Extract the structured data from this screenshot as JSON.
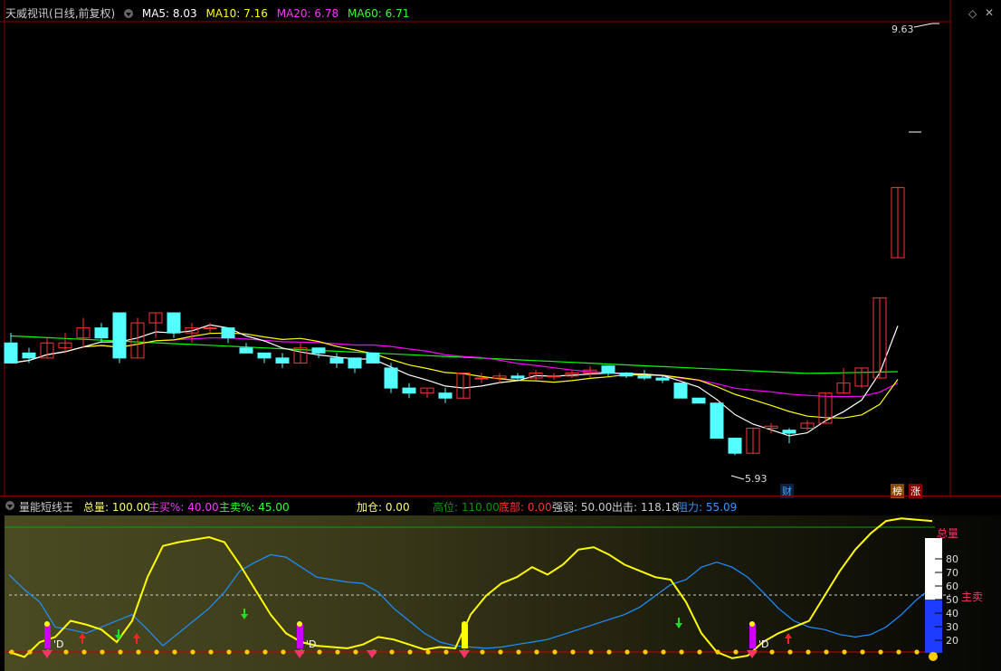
{
  "main": {
    "stock_name": "天威视讯",
    "period": "(日线,前复权)",
    "ma5_label": "MA5: 8.03",
    "ma10_label": "MA10: 7.16",
    "ma20_label": "MA20: 6.78",
    "ma60_label": "MA60: 6.71",
    "high_label": "9.63",
    "low_label": "5.93",
    "badge_cai": "财",
    "badge_bang": "榜",
    "badge_zhang": "涨",
    "colors": {
      "ma5": "#ffffff",
      "ma10": "#ffff00",
      "ma20": "#ff00ff",
      "ma60": "#00ff00",
      "up": "#ff3333",
      "down": "#54ffff"
    }
  },
  "sub": {
    "indicator_name": "量能短线王",
    "total": "总量: 100.00",
    "buy_pct": "主买%: 40.00",
    "sell_pct": "主卖%: 45.00",
    "add_pos": "加仓: 0.00",
    "high_pos": "高位: 110.00",
    "bottom": "底部: 0.00",
    "strength": "强弱: 50.00",
    "exit": "出击: 118.18",
    "resistance": "阻力: 55.09",
    "gauge_total_label": "总量",
    "gauge_sell_label": "主卖",
    "gauge_ticks": [
      "80",
      "70",
      "60",
      "50",
      "40",
      "30",
      "20"
    ],
    "d_label": "D"
  },
  "chart_data": {
    "type": "candlestick",
    "price_range": [
      5.6,
      10.2
    ],
    "candles_ohlc_approx": [
      [
        7.05,
        7.15,
        6.85,
        6.85
      ],
      [
        6.95,
        7.0,
        6.85,
        6.9
      ],
      [
        6.9,
        7.1,
        6.9,
        7.05
      ],
      [
        7.0,
        7.15,
        6.95,
        7.05
      ],
      [
        7.1,
        7.3,
        7.0,
        7.2
      ],
      [
        7.2,
        7.25,
        7.05,
        7.1
      ],
      [
        7.35,
        7.35,
        6.85,
        6.9
      ],
      [
        6.9,
        7.3,
        6.9,
        7.25
      ],
      [
        7.25,
        7.35,
        7.1,
        7.35
      ],
      [
        7.35,
        7.35,
        7.1,
        7.15
      ],
      [
        7.15,
        7.25,
        7.05,
        7.2
      ],
      [
        7.2,
        7.25,
        7.15,
        7.2
      ],
      [
        7.2,
        7.2,
        7.05,
        7.1
      ],
      [
        7.0,
        7.05,
        6.95,
        6.95
      ],
      [
        6.95,
        6.95,
        6.85,
        6.9
      ],
      [
        6.9,
        6.95,
        6.8,
        6.85
      ],
      [
        6.85,
        7.05,
        6.85,
        7.0
      ],
      [
        7.0,
        7.0,
        6.9,
        6.95
      ],
      [
        6.9,
        6.95,
        6.8,
        6.85
      ],
      [
        6.9,
        6.9,
        6.75,
        6.8
      ],
      [
        6.95,
        6.95,
        6.85,
        6.85
      ],
      [
        6.8,
        6.85,
        6.55,
        6.6
      ],
      [
        6.6,
        6.65,
        6.5,
        6.55
      ],
      [
        6.55,
        6.6,
        6.5,
        6.6
      ],
      [
        6.55,
        6.6,
        6.45,
        6.5
      ],
      [
        6.5,
        6.75,
        6.5,
        6.75
      ],
      [
        6.7,
        6.75,
        6.65,
        6.7
      ],
      [
        6.7,
        6.75,
        6.65,
        6.72
      ],
      [
        6.72,
        6.75,
        6.68,
        6.7
      ],
      [
        6.7,
        6.78,
        6.68,
        6.75
      ],
      [
        6.72,
        6.75,
        6.68,
        6.72
      ],
      [
        6.72,
        6.78,
        6.7,
        6.75
      ],
      [
        6.75,
        6.82,
        6.7,
        6.78
      ],
      [
        6.82,
        6.82,
        6.72,
        6.75
      ],
      [
        6.75,
        6.76,
        6.7,
        6.72
      ],
      [
        6.72,
        6.78,
        6.68,
        6.7
      ],
      [
        6.7,
        6.72,
        6.65,
        6.68
      ],
      [
        6.65,
        6.65,
        6.5,
        6.5
      ],
      [
        6.5,
        6.5,
        6.45,
        6.45
      ],
      [
        6.45,
        6.45,
        6.1,
        6.1
      ],
      [
        6.1,
        6.1,
        5.93,
        5.95
      ],
      [
        5.95,
        6.2,
        5.95,
        6.2
      ],
      [
        6.2,
        6.25,
        6.15,
        6.22
      ],
      [
        6.18,
        6.2,
        6.05,
        6.15
      ],
      [
        6.2,
        6.28,
        6.18,
        6.25
      ],
      [
        6.25,
        6.55,
        6.25,
        6.55
      ],
      [
        6.55,
        6.8,
        6.55,
        6.65
      ],
      [
        6.62,
        6.8,
        6.6,
        6.8
      ],
      [
        6.7,
        7.5,
        6.7,
        7.5
      ],
      [
        7.9,
        8.6,
        7.9,
        8.6
      ]
    ]
  }
}
